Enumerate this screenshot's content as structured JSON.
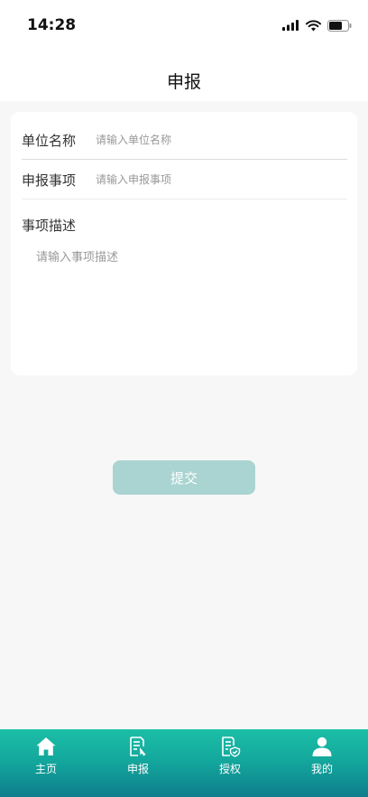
{
  "status": {
    "time": "14:28"
  },
  "header": {
    "title": "申报"
  },
  "form": {
    "unit_name_label": "单位名称",
    "unit_name_placeholder": "请输入单位名称",
    "item_label": "申报事项",
    "item_placeholder": "请输入申报事项",
    "desc_label": "事项描述",
    "desc_placeholder": "请输入事项描述"
  },
  "submit_label": "提交",
  "colors": {
    "accent": "#1cbfa6",
    "button_disabled": "#a9d4d1"
  },
  "tabbar": {
    "items": [
      {
        "label": "主页",
        "icon": "home-icon"
      },
      {
        "label": "申报",
        "icon": "report-icon"
      },
      {
        "label": "授权",
        "icon": "authorize-icon"
      },
      {
        "label": "我的",
        "icon": "user-icon"
      }
    ]
  }
}
